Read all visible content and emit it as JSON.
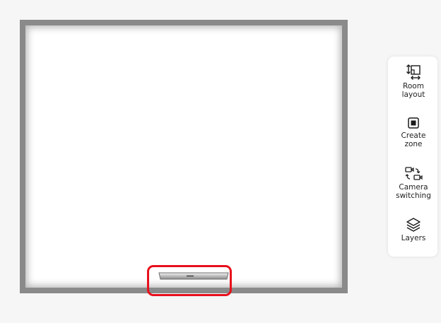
{
  "toolbar": {
    "items": [
      {
        "label": "Room\nlayout",
        "icon": "room-layout-icon"
      },
      {
        "label": "Create\nzone",
        "icon": "create-zone-icon"
      },
      {
        "label": "Camera\nswitching",
        "icon": "camera-switching-icon"
      },
      {
        "label": "Layers",
        "icon": "layers-icon"
      }
    ]
  },
  "colors": {
    "wall": "#8a8a8a",
    "floor": "#ffffff",
    "highlight": "#e8101c",
    "icon": "#1a1a1a"
  }
}
